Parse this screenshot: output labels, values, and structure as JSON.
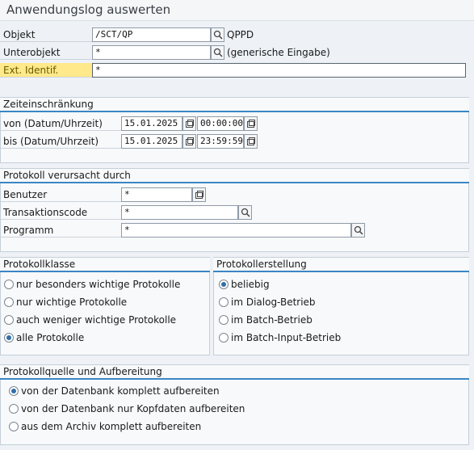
{
  "title": "Anwendungslog auswerten",
  "header_fields": [
    {
      "label": "Objekt",
      "value": "/SCT/QP",
      "after": "QPPD",
      "highlight": false
    },
    {
      "label": "Unterobjekt",
      "value": "*",
      "after": "(generische Eingabe)",
      "highlight": false
    },
    {
      "label": "Ext. Identif.",
      "value": "*",
      "after": "",
      "highlight": true
    }
  ],
  "time_group": {
    "title": "Zeiteinschränkung",
    "rows": [
      {
        "label": "von (Datum/Uhrzeit)",
        "date": "15.01.2025",
        "time": "00:00:00"
      },
      {
        "label": "bis (Datum/Uhrzeit)",
        "date": "15.01.2025",
        "time": "23:59:59"
      }
    ]
  },
  "cause_group": {
    "title": "Protokoll verursacht durch",
    "rows": [
      {
        "label": "Benutzer",
        "value": "*"
      },
      {
        "label": "Transaktionscode",
        "value": "*"
      },
      {
        "label": "Programm",
        "value": "*"
      }
    ]
  },
  "class_group": {
    "title": "Protokollklasse",
    "options": [
      {
        "label": "nur besonders wichtige Protokolle",
        "selected": false
      },
      {
        "label": "nur wichtige Protokolle",
        "selected": false
      },
      {
        "label": "auch weniger wichtige Protokolle",
        "selected": false
      },
      {
        "label": "alle Protokolle",
        "selected": true
      }
    ]
  },
  "creation_group": {
    "title": "Protokollerstellung",
    "options": [
      {
        "label": "beliebig",
        "selected": true
      },
      {
        "label": "im Dialog-Betrieb",
        "selected": false
      },
      {
        "label": "im Batch-Betrieb",
        "selected": false
      },
      {
        "label": "im Batch-Input-Betrieb",
        "selected": false
      }
    ]
  },
  "source_group": {
    "title": "Protokollquelle und Aufbereitung",
    "options": [
      {
        "label": "von der Datenbank komplett aufbereiten",
        "selected": true
      },
      {
        "label": "von der Datenbank nur Kopfdaten aufbereiten",
        "selected": false
      },
      {
        "label": "aus dem Archiv komplett aufbereiten",
        "selected": false
      }
    ]
  },
  "colors": {
    "accent": "#3b86c4",
    "highlight": "#ffe98a",
    "radio_dot": "#2f6fa8"
  },
  "icons": {
    "search": "search-icon",
    "calendar": "calendar-icon",
    "clock": "clock-icon",
    "value_help": "value-help-icon"
  }
}
